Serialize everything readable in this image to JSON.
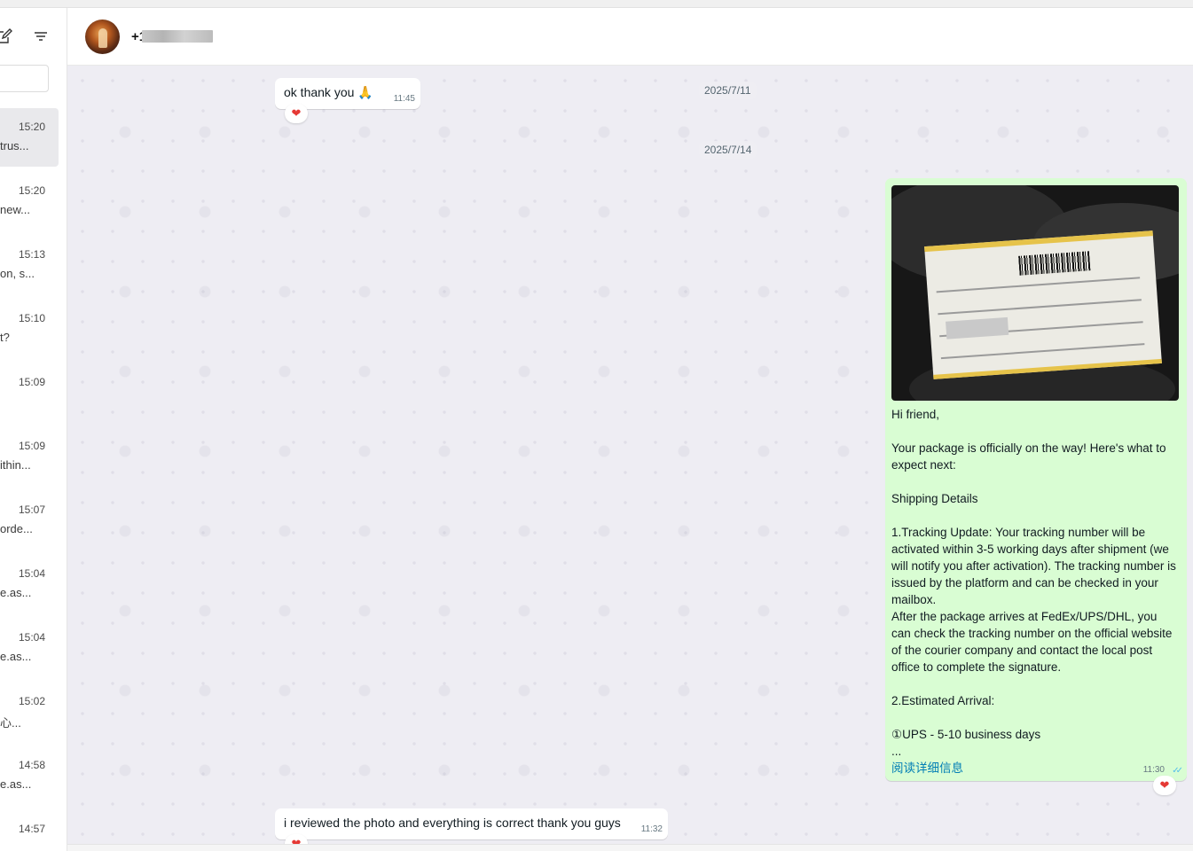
{
  "contact": {
    "name": "+1"
  },
  "sidebar": {
    "chats": [
      {
        "time": "15:20",
        "preview": "trus..."
      },
      {
        "time": "15:20",
        "preview": "new..."
      },
      {
        "time": "15:13",
        "preview": "on, s..."
      },
      {
        "time": "15:10",
        "preview": "t?"
      },
      {
        "time": "15:09",
        "preview": ""
      },
      {
        "time": "15:09",
        "preview": "ithin..."
      },
      {
        "time": "15:07",
        "preview": "orde..."
      },
      {
        "time": "15:04",
        "preview": "e.as..."
      },
      {
        "time": "15:04",
        "preview": "e.as..."
      },
      {
        "time": "15:02",
        "preview": "心..."
      },
      {
        "time": "14:58",
        "preview": "e.as..."
      },
      {
        "time": "14:57",
        "preview": ""
      }
    ]
  },
  "messages": {
    "m1": {
      "text": "ok thank you 🙏",
      "time": "11:45",
      "reaction": "❤"
    },
    "date1": "2025/7/11",
    "date2": "2025/7/14",
    "out": {
      "lines": [
        "Hi friend,",
        "",
        "Your package is officially on the way!  Here's what to expect next:",
        "",
        "Shipping Details",
        "",
        "1.Tracking Update: Your tracking number will be activated within 3-5 working days after shipment (we will notify you after activation). The tracking number is issued by the platform and can be checked in your mailbox.",
        "After the package arrives at FedEx/UPS/DHL, you can check the tracking number on the official website of the courier company and contact the local post office to complete the signature.",
        "",
        "2.Estimated Arrival:",
        "",
        "①UPS - 5-10 business days",
        "..."
      ],
      "read_more": "阅读详细信息",
      "time": "11:30",
      "ticks": "✓✓",
      "reaction": "❤"
    },
    "m2": {
      "text": "i reviewed the photo and everything is correct thank you guys",
      "time": "11:32",
      "reaction": "❤"
    }
  },
  "colors": {
    "outgoing_bubble": "#d9fdd3",
    "incoming_bubble": "#ffffff",
    "chat_bg": "#eeedf3",
    "link": "#027eb5",
    "read_ticks": "#53bdeb"
  }
}
